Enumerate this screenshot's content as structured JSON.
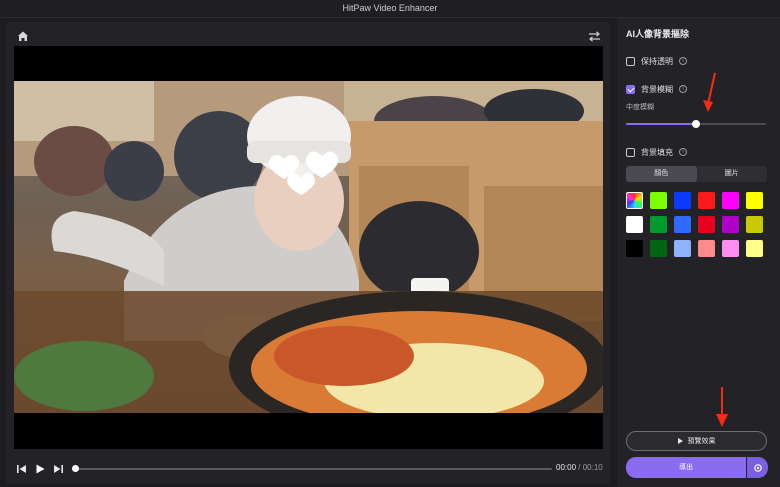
{
  "window": {
    "title": "HitPaw Video Enhancer"
  },
  "player": {
    "current_time": "00:00",
    "separator": " / ",
    "total_time": "00:10",
    "progress": 0
  },
  "panel": {
    "title": "AI人像背景摳除",
    "keep_transparent": {
      "label": "保持透明",
      "checked": false
    },
    "bg_blur": {
      "label": "背景模糊",
      "checked": true
    },
    "blur_level_label": "中度模糊",
    "blur_level": 0.5,
    "bg_fill": {
      "label": "背景填充",
      "checked": false
    },
    "tabs": [
      {
        "label": "顏色",
        "active": true
      },
      {
        "label": "圖片",
        "active": false
      }
    ],
    "swatch_colors": [
      "rainbow",
      "#7cff00",
      "#0a3cff",
      "#ff1a1a",
      "#ff00ff",
      "#ffff00",
      "#ffffff",
      "#009a2e",
      "#2f6bff",
      "#e8001f",
      "#b000c8",
      "#c9c900",
      "#000000",
      "#006614",
      "#8fb2ff",
      "#ff8a8a",
      "#ff8cf0",
      "#ffff8a"
    ],
    "preview_label": "預覽效果",
    "export_label": "導出"
  },
  "annotations": {
    "arrow_color": "#ff2a12"
  }
}
